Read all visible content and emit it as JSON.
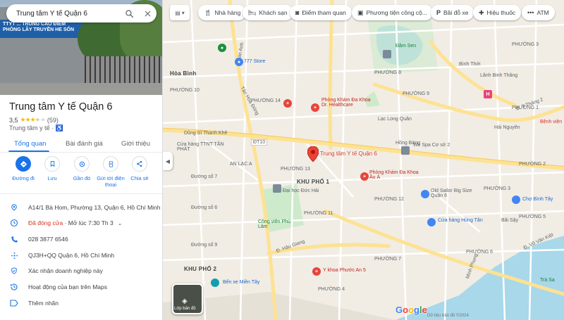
{
  "search": {
    "query": "Trung tâm Y tế Quận 6"
  },
  "photo": {
    "banner_text": "TTYT ... TRUNG CAO ĐIỂM PHÒNG LÂY TRUYỀN HE SỐN"
  },
  "place": {
    "title": "Trung tâm Y tế Quận 6",
    "rating": "3,5",
    "stars": 3.5,
    "reviews": "(59)",
    "category": "Trung tâm y tế ·"
  },
  "tabs": [
    {
      "label": "Tổng quan",
      "active": true
    },
    {
      "label": "Bài đánh giá",
      "active": false
    },
    {
      "label": "Giới thiệu",
      "active": false
    }
  ],
  "actions": [
    {
      "label": "Đường đi",
      "icon": "directions-icon"
    },
    {
      "label": "Lưu",
      "icon": "bookmark-icon"
    },
    {
      "label": "Gần đó",
      "icon": "nearby-icon"
    },
    {
      "label": "Gửi tới điện thoại",
      "icon": "send-to-phone-icon"
    },
    {
      "label": "Chia sẻ",
      "icon": "share-icon"
    }
  ],
  "info": {
    "address": "A14/1 Bà Hom, Phường 13, Quận 6, Hồ Chí Minh",
    "hours_status": "Đã đóng cửa",
    "hours_next": "· Mở lúc 7:30 Th 3",
    "phone": "028 3877 6546",
    "plus_code": "QJ3H+QQ Quận 6, Hồ Chí Minh",
    "claim": "Xác nhận doanh nghiệp này",
    "activity": "Hoạt động của bạn trên Maps",
    "label": "Thêm nhãn"
  },
  "chips": [
    {
      "label": "Nhà hàng",
      "icon": "restaurant-icon"
    },
    {
      "label": "Khách sạn",
      "icon": "hotel-icon"
    },
    {
      "label": "Điểm tham quan",
      "icon": "camera-icon"
    },
    {
      "label": "Phương tiện công cộ...",
      "icon": "transit-icon"
    },
    {
      "label": "Bãi đỗ xe",
      "icon": "parking-icon"
    },
    {
      "label": "Hiệu thuốc",
      "icon": "pharmacy-icon"
    },
    {
      "label": "ATM",
      "icon": "atm-icon"
    }
  ],
  "map": {
    "pin_label": "Trung tâm Y tế Quận 6",
    "layers_label": "Lớp bản đồ",
    "logo": "Google",
    "copyright": "Dữ liệu bản đồ ©2024",
    "labels": {
      "phan_anh": "Phan Anh",
      "hoa_binh": "Hòa Bình",
      "dam_sen": "Đầm Sen",
      "phuong_8": "PHƯỜNG 8",
      "phuong_9": "PHƯỜNG 9",
      "phuong_3_top": "PHƯỜNG 3",
      "phuong_1": "PHƯỜNG 1",
      "phuong_10": "PHƯỜNG 10",
      "phuong_14": "PHƯỜNG 14",
      "phuong_13": "PHƯỜNG 13",
      "phuong_11": "PHƯỜNG 11",
      "phuong_12": "PHƯỜNG 12",
      "phuong_3_mid": "PHƯỜNG 3",
      "phuong_2": "PHƯỜNG 2",
      "phuong_7": "PHƯỜNG 7",
      "phuong_6": "PHƯỜNG 6",
      "phuong_5": "PHƯỜNG 5",
      "phuong_4": "PHƯỜNG 4",
      "store_777": "777 Store",
      "binh_thoi": "Bình Thới",
      "lanh_binh_thang": "Lãnh Binh Thăng",
      "tan_hoa_dong": "Tân Hòa Đông",
      "lac_long_quan": "Lạc Long Quân",
      "dung_si_thanh_khe": "Dũng Sĩ Thanh Khê",
      "dt10": "ĐT10",
      "cua_hang_tan_phat": "Cửa hàng TTNT TÂN PHÁT",
      "an_lac_a": "AN LẠC A",
      "khu_pho_1": "KHU PHỐ 1",
      "khu_pho_2": "KHU PHỐ 2",
      "duong_so_7": "Đường số 7",
      "duong_so_6": "Đường số 6",
      "duong_so_9": "Đường số 9",
      "dai_hoc_duc_hai": "Đại học Đức Hải",
      "cong_vien_phu_lam": "Công viên Phú Lâm",
      "phong_kham_healthcare": "Phòng Khám Đa Khoa Dr. Healthcare",
      "phong_kham_au_a": "Phòng Khám Đa Khoa Âu Á",
      "we_spa": "We Spa Cơ sở 2",
      "old_sailor": "Old Sailor Big Size Quận 6",
      "cho_binh_tay": "Chợ Bình Tây",
      "cua_hang_hung_tan": "Cửa hàng Hùng Tân",
      "bai_say": "Bãi Sậy",
      "y_khoa_phuoc_an": "Y khoa Phước An 5",
      "ben_xe_mien_tay": "Bến xe Miền Tây",
      "hau_giang": "Đ. Hậu Giang",
      "vo_van_kiet": "Đ. Võ Văn Kiệt",
      "benh_vien": "Bệnh viện",
      "tra_sa": "Trà Sa",
      "ba_thang_hai": "Đ. 3 Tháng 2",
      "hai_nguyen": "Hải Nguyên",
      "hong_bang": "Hồng Bàng",
      "minh_phung": "Minh Phụng"
    }
  }
}
